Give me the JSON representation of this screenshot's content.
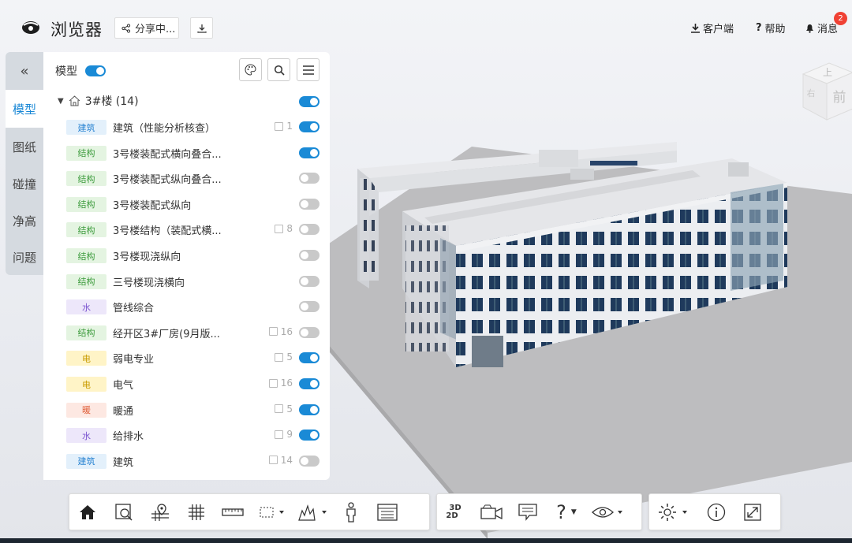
{
  "app": {
    "title": "浏览器"
  },
  "header": {
    "share_label": "分享中...",
    "client_label": "客户端",
    "help_label": "帮助",
    "message_label": "消息",
    "message_count": "2"
  },
  "vtabs": [
    {
      "label": "模型",
      "active": true
    },
    {
      "label": "图纸"
    },
    {
      "label": "碰撞"
    },
    {
      "label": "净高"
    },
    {
      "label": "问题"
    }
  ],
  "panel": {
    "title": "模型",
    "root_label": "3#楼 (14)",
    "items": [
      {
        "tag": "建筑",
        "tag_color": "#e3f0fb",
        "tag_text_color": "#2a84d2",
        "name": "建筑（性能分析核查）",
        "count": "1",
        "on": true
      },
      {
        "tag": "结构",
        "tag_color": "#e4f4e1",
        "tag_text_color": "#3c9b3c",
        "name": "3号楼装配式横向叠合...",
        "count": "",
        "on": true
      },
      {
        "tag": "结构",
        "tag_color": "#e4f4e1",
        "tag_text_color": "#3c9b3c",
        "name": "3号楼装配式纵向叠合...",
        "count": "",
        "on": false
      },
      {
        "tag": "结构",
        "tag_color": "#e4f4e1",
        "tag_text_color": "#3c9b3c",
        "name": "3号楼装配式纵向",
        "count": "",
        "on": false
      },
      {
        "tag": "结构",
        "tag_color": "#e4f4e1",
        "tag_text_color": "#3c9b3c",
        "name": "3号楼结构（装配式横...",
        "count": "8",
        "on": false
      },
      {
        "tag": "结构",
        "tag_color": "#e4f4e1",
        "tag_text_color": "#3c9b3c",
        "name": "3号楼现浇纵向",
        "count": "",
        "on": false
      },
      {
        "tag": "结构",
        "tag_color": "#e4f4e1",
        "tag_text_color": "#3c9b3c",
        "name": "三号楼现浇横向",
        "count": "",
        "on": false
      },
      {
        "tag": "水",
        "tag_color": "#ede7fa",
        "tag_text_color": "#7b55d0",
        "name": "管线综合",
        "count": "",
        "on": false
      },
      {
        "tag": "结构",
        "tag_color": "#e4f4e1",
        "tag_text_color": "#3c9b3c",
        "name": "经开区3#厂房(9月版...",
        "count": "16",
        "on": false
      },
      {
        "tag": "电",
        "tag_color": "#fff4c7",
        "tag_text_color": "#c99b00",
        "name": "弱电专业",
        "count": "5",
        "on": true
      },
      {
        "tag": "电",
        "tag_color": "#fff4c7",
        "tag_text_color": "#c99b00",
        "name": "电气",
        "count": "16",
        "on": true
      },
      {
        "tag": "暖",
        "tag_color": "#fde8e2",
        "tag_text_color": "#e0603b",
        "name": "暖通",
        "count": "5",
        "on": true
      },
      {
        "tag": "水",
        "tag_color": "#ede7fa",
        "tag_text_color": "#7b55d0",
        "name": "给排水",
        "count": "9",
        "on": true
      },
      {
        "tag": "建筑",
        "tag_color": "#e3f0fb",
        "tag_text_color": "#2a84d2",
        "name": "建筑",
        "count": "14",
        "on": false
      }
    ]
  },
  "viewcube": {
    "top": "上",
    "front": "前",
    "right": "右"
  },
  "toolbar": {
    "view_3d": "3D",
    "view_2d": "2D"
  },
  "colors": {
    "accent": "#1a8ad6",
    "badge": "#f04134"
  }
}
